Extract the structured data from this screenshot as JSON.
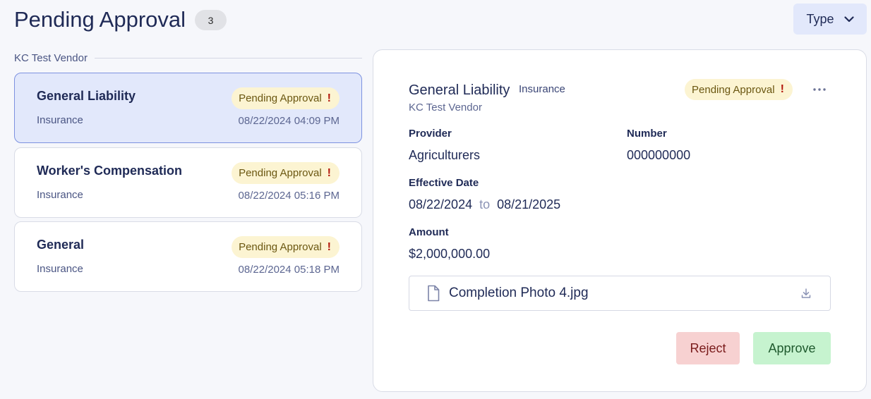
{
  "header": {
    "title": "Pending Approval",
    "count": "3",
    "type_button_label": "Type"
  },
  "vendor_group": "KC Test Vendor",
  "list": [
    {
      "title": "General Liability",
      "category": "Insurance",
      "status": "Pending Approval",
      "status_mark": "!",
      "date": "08/22/2024 04:09 PM",
      "selected": true
    },
    {
      "title": "Worker's Compensation",
      "category": "Insurance",
      "status": "Pending Approval",
      "status_mark": "!",
      "date": "08/22/2024 05:16 PM",
      "selected": false
    },
    {
      "title": "General",
      "category": "Insurance",
      "status": "Pending Approval",
      "status_mark": "!",
      "date": "08/22/2024 05:18 PM",
      "selected": false
    }
  ],
  "detail": {
    "title": "General Liability",
    "type": "Insurance",
    "vendor": "KC Test Vendor",
    "status": "Pending Approval",
    "status_mark": "!",
    "provider_label": "Provider",
    "provider": "Agriculturers",
    "number_label": "Number",
    "number": "000000000",
    "effective_label": "Effective Date",
    "effective_from": "08/22/2024",
    "effective_to_word": "to",
    "effective_to": "08/21/2025",
    "amount_label": "Amount",
    "amount": "$2,000,000.00",
    "attachment": "Completion Photo 4.jpg",
    "reject_label": "Reject",
    "approve_label": "Approve"
  },
  "colors": {
    "accent": "#1f2a56",
    "selected_bg": "#e2e8fb",
    "pending_bg": "#fcf4d2",
    "alert": "#b3170c",
    "reject_bg": "#f7d1d1",
    "approve_bg": "#c6f3cf"
  },
  "icons": [
    "chevron-down-icon",
    "exclamation-icon",
    "more-horizontal-icon",
    "file-icon",
    "download-icon"
  ]
}
